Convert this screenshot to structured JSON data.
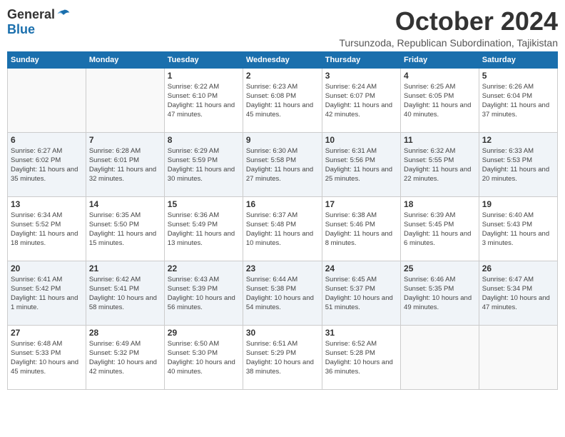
{
  "logo": {
    "general": "General",
    "blue": "Blue"
  },
  "title": "October 2024",
  "location": "Tursunzoda, Republican Subordination, Tajikistan",
  "days_of_week": [
    "Sunday",
    "Monday",
    "Tuesday",
    "Wednesday",
    "Thursday",
    "Friday",
    "Saturday"
  ],
  "weeks": [
    [
      {
        "day": "",
        "sunrise": "",
        "sunset": "",
        "daylight": ""
      },
      {
        "day": "",
        "sunrise": "",
        "sunset": "",
        "daylight": ""
      },
      {
        "day": "1",
        "sunrise": "Sunrise: 6:22 AM",
        "sunset": "Sunset: 6:10 PM",
        "daylight": "Daylight: 11 hours and 47 minutes."
      },
      {
        "day": "2",
        "sunrise": "Sunrise: 6:23 AM",
        "sunset": "Sunset: 6:08 PM",
        "daylight": "Daylight: 11 hours and 45 minutes."
      },
      {
        "day": "3",
        "sunrise": "Sunrise: 6:24 AM",
        "sunset": "Sunset: 6:07 PM",
        "daylight": "Daylight: 11 hours and 42 minutes."
      },
      {
        "day": "4",
        "sunrise": "Sunrise: 6:25 AM",
        "sunset": "Sunset: 6:05 PM",
        "daylight": "Daylight: 11 hours and 40 minutes."
      },
      {
        "day": "5",
        "sunrise": "Sunrise: 6:26 AM",
        "sunset": "Sunset: 6:04 PM",
        "daylight": "Daylight: 11 hours and 37 minutes."
      }
    ],
    [
      {
        "day": "6",
        "sunrise": "Sunrise: 6:27 AM",
        "sunset": "Sunset: 6:02 PM",
        "daylight": "Daylight: 11 hours and 35 minutes."
      },
      {
        "day": "7",
        "sunrise": "Sunrise: 6:28 AM",
        "sunset": "Sunset: 6:01 PM",
        "daylight": "Daylight: 11 hours and 32 minutes."
      },
      {
        "day": "8",
        "sunrise": "Sunrise: 6:29 AM",
        "sunset": "Sunset: 5:59 PM",
        "daylight": "Daylight: 11 hours and 30 minutes."
      },
      {
        "day": "9",
        "sunrise": "Sunrise: 6:30 AM",
        "sunset": "Sunset: 5:58 PM",
        "daylight": "Daylight: 11 hours and 27 minutes."
      },
      {
        "day": "10",
        "sunrise": "Sunrise: 6:31 AM",
        "sunset": "Sunset: 5:56 PM",
        "daylight": "Daylight: 11 hours and 25 minutes."
      },
      {
        "day": "11",
        "sunrise": "Sunrise: 6:32 AM",
        "sunset": "Sunset: 5:55 PM",
        "daylight": "Daylight: 11 hours and 22 minutes."
      },
      {
        "day": "12",
        "sunrise": "Sunrise: 6:33 AM",
        "sunset": "Sunset: 5:53 PM",
        "daylight": "Daylight: 11 hours and 20 minutes."
      }
    ],
    [
      {
        "day": "13",
        "sunrise": "Sunrise: 6:34 AM",
        "sunset": "Sunset: 5:52 PM",
        "daylight": "Daylight: 11 hours and 18 minutes."
      },
      {
        "day": "14",
        "sunrise": "Sunrise: 6:35 AM",
        "sunset": "Sunset: 5:50 PM",
        "daylight": "Daylight: 11 hours and 15 minutes."
      },
      {
        "day": "15",
        "sunrise": "Sunrise: 6:36 AM",
        "sunset": "Sunset: 5:49 PM",
        "daylight": "Daylight: 11 hours and 13 minutes."
      },
      {
        "day": "16",
        "sunrise": "Sunrise: 6:37 AM",
        "sunset": "Sunset: 5:48 PM",
        "daylight": "Daylight: 11 hours and 10 minutes."
      },
      {
        "day": "17",
        "sunrise": "Sunrise: 6:38 AM",
        "sunset": "Sunset: 5:46 PM",
        "daylight": "Daylight: 11 hours and 8 minutes."
      },
      {
        "day": "18",
        "sunrise": "Sunrise: 6:39 AM",
        "sunset": "Sunset: 5:45 PM",
        "daylight": "Daylight: 11 hours and 6 minutes."
      },
      {
        "day": "19",
        "sunrise": "Sunrise: 6:40 AM",
        "sunset": "Sunset: 5:43 PM",
        "daylight": "Daylight: 11 hours and 3 minutes."
      }
    ],
    [
      {
        "day": "20",
        "sunrise": "Sunrise: 6:41 AM",
        "sunset": "Sunset: 5:42 PM",
        "daylight": "Daylight: 11 hours and 1 minute."
      },
      {
        "day": "21",
        "sunrise": "Sunrise: 6:42 AM",
        "sunset": "Sunset: 5:41 PM",
        "daylight": "Daylight: 10 hours and 58 minutes."
      },
      {
        "day": "22",
        "sunrise": "Sunrise: 6:43 AM",
        "sunset": "Sunset: 5:39 PM",
        "daylight": "Daylight: 10 hours and 56 minutes."
      },
      {
        "day": "23",
        "sunrise": "Sunrise: 6:44 AM",
        "sunset": "Sunset: 5:38 PM",
        "daylight": "Daylight: 10 hours and 54 minutes."
      },
      {
        "day": "24",
        "sunrise": "Sunrise: 6:45 AM",
        "sunset": "Sunset: 5:37 PM",
        "daylight": "Daylight: 10 hours and 51 minutes."
      },
      {
        "day": "25",
        "sunrise": "Sunrise: 6:46 AM",
        "sunset": "Sunset: 5:35 PM",
        "daylight": "Daylight: 10 hours and 49 minutes."
      },
      {
        "day": "26",
        "sunrise": "Sunrise: 6:47 AM",
        "sunset": "Sunset: 5:34 PM",
        "daylight": "Daylight: 10 hours and 47 minutes."
      }
    ],
    [
      {
        "day": "27",
        "sunrise": "Sunrise: 6:48 AM",
        "sunset": "Sunset: 5:33 PM",
        "daylight": "Daylight: 10 hours and 45 minutes."
      },
      {
        "day": "28",
        "sunrise": "Sunrise: 6:49 AM",
        "sunset": "Sunset: 5:32 PM",
        "daylight": "Daylight: 10 hours and 42 minutes."
      },
      {
        "day": "29",
        "sunrise": "Sunrise: 6:50 AM",
        "sunset": "Sunset: 5:30 PM",
        "daylight": "Daylight: 10 hours and 40 minutes."
      },
      {
        "day": "30",
        "sunrise": "Sunrise: 6:51 AM",
        "sunset": "Sunset: 5:29 PM",
        "daylight": "Daylight: 10 hours and 38 minutes."
      },
      {
        "day": "31",
        "sunrise": "Sunrise: 6:52 AM",
        "sunset": "Sunset: 5:28 PM",
        "daylight": "Daylight: 10 hours and 36 minutes."
      },
      {
        "day": "",
        "sunrise": "",
        "sunset": "",
        "daylight": ""
      },
      {
        "day": "",
        "sunrise": "",
        "sunset": "",
        "daylight": ""
      }
    ]
  ]
}
